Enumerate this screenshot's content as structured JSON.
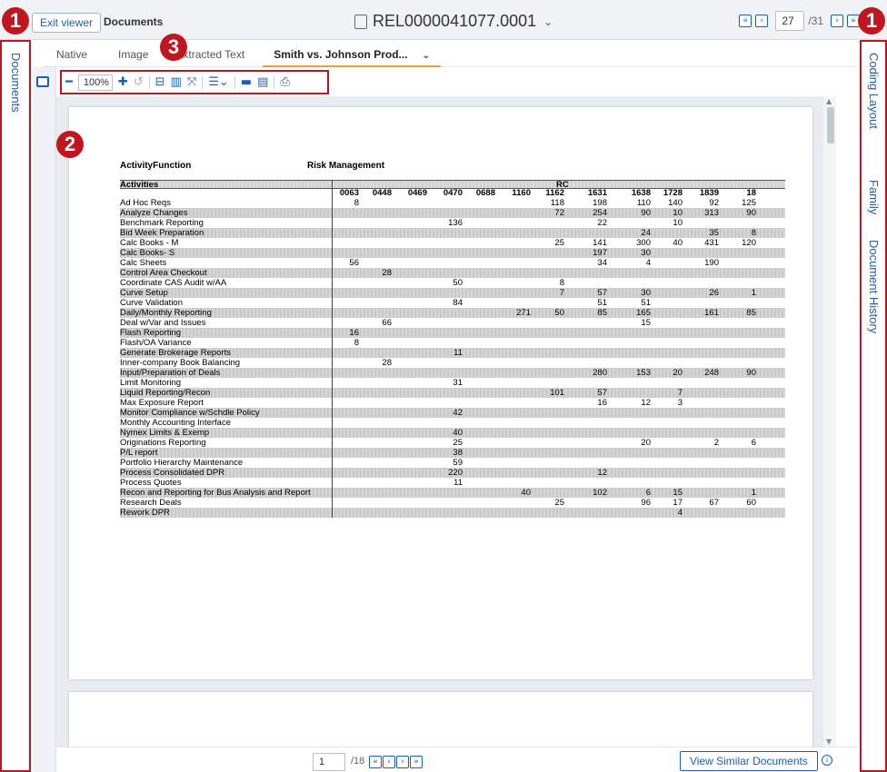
{
  "markers": {
    "left": "1",
    "right": "1",
    "toolbar": "3",
    "viewer": "2"
  },
  "header": {
    "exit_viewer": "Exit viewer",
    "documents": "Documents",
    "doc_title": "REL0000041077.0001",
    "current_page": "27",
    "total_pages": "/31"
  },
  "left_rail": {
    "label": "Documents"
  },
  "right_rail": {
    "coding_layout": "Coding Layout",
    "family": "Family",
    "document_history": "Document History"
  },
  "tabs": [
    {
      "label": "Native"
    },
    {
      "label": "Image"
    },
    {
      "label": "Extracted Text"
    },
    {
      "label": "Smith vs. Johnson Prod..."
    }
  ],
  "toolbar": {
    "zoom": "100%"
  },
  "document": {
    "activity_function_label": "ActivityFunction",
    "activity_function_value": "Risk Management",
    "activities_header": "Activities",
    "rc_header": "RC",
    "columns": [
      "0063",
      "0448",
      "0469",
      "0470",
      "0688",
      "1160",
      "1162",
      "1631",
      "1638",
      "1728",
      "1839",
      "18"
    ],
    "rows": [
      {
        "name": "Ad Hoc Reqs",
        "cells": {
          "0063": "8",
          "1162": "118",
          "1631": "198",
          "1638": "110",
          "1728": "140",
          "1839": "92",
          "18": "125"
        }
      },
      {
        "name": "Analyze Changes",
        "cells": {
          "1162": "72",
          "1631": "254",
          "1638": "90",
          "1728": "10",
          "1839": "313",
          "18": "90"
        }
      },
      {
        "name": "Benchmark Reporting",
        "cells": {
          "0470": "136",
          "1631": "22",
          "1728": "10"
        }
      },
      {
        "name": "Bid Week Preparation",
        "cells": {
          "1638": "24",
          "1839": "35",
          "18": "8"
        }
      },
      {
        "name": "Calc Books - M",
        "cells": {
          "1162": "25",
          "1631": "141",
          "1638": "300",
          "1728": "40",
          "1839": "431",
          "18": "120"
        }
      },
      {
        "name": "Calc Books- S",
        "cells": {
          "1631": "197",
          "1638": "30"
        }
      },
      {
        "name": "Calc Sheets",
        "cells": {
          "0063": "56",
          "1631": "34",
          "1638": "4",
          "1839": "190"
        }
      },
      {
        "name": "Control Area Checkout",
        "cells": {
          "0448": "28"
        }
      },
      {
        "name": "Coordinate CAS Audit w/AA",
        "cells": {
          "0470": "50",
          "1162": "8"
        }
      },
      {
        "name": "Curve Setup",
        "cells": {
          "1162": "7",
          "1631": "57",
          "1638": "30",
          "1839": "26",
          "18": "1"
        }
      },
      {
        "name": "Curve Validation",
        "cells": {
          "0470": "84",
          "1631": "51",
          "1638": "51"
        }
      },
      {
        "name": "Daily/Monthly Reporting",
        "cells": {
          "1160": "271",
          "1162": "50",
          "1631": "85",
          "1638": "165",
          "1839": "161",
          "18": "85"
        }
      },
      {
        "name": "Deal w/Var and Issues",
        "cells": {
          "0448": "66",
          "1638": "15"
        }
      },
      {
        "name": "Flash Reporting",
        "cells": {
          "0063": "16"
        }
      },
      {
        "name": "Flash/OA Variance",
        "cells": {
          "0063": "8"
        }
      },
      {
        "name": "Generate Brokerage Reports",
        "cells": {
          "0470": "11"
        }
      },
      {
        "name": "Inner-company Book Balancing",
        "cells": {
          "0448": "28"
        }
      },
      {
        "name": "Input/Preparation of Deals",
        "cells": {
          "1631": "280",
          "1638": "153",
          "1728": "20",
          "1839": "248",
          "18": "90"
        }
      },
      {
        "name": "Limit Monitoring",
        "cells": {
          "0470": "31"
        }
      },
      {
        "name": "Liquid Reporting/Recon",
        "cells": {
          "1162": "101",
          "1631": "57",
          "1728": "7"
        }
      },
      {
        "name": "Max Exposure Report",
        "cells": {
          "1631": "16",
          "1638": "12",
          "1728": "3"
        }
      },
      {
        "name": "Monitor Compliance w/Schdle Policy",
        "cells": {
          "0470": "42"
        }
      },
      {
        "name": "Monthly Accounting Interface",
        "cells": {}
      },
      {
        "name": "Nymex Limits & Exemp",
        "cells": {
          "0470": "40"
        }
      },
      {
        "name": "Originations Reporting",
        "cells": {
          "0470": "25",
          "1638": "20",
          "1839": "2",
          "18": "6"
        }
      },
      {
        "name": "P/L report",
        "cells": {
          "0470": "38"
        }
      },
      {
        "name": "Portfolio Hierarchy Maintenance",
        "cells": {
          "0470": "59"
        }
      },
      {
        "name": "Process Consolidated DPR",
        "cells": {
          "0470": "220",
          "1631": "12"
        }
      },
      {
        "name": "Process Quotes",
        "cells": {
          "0470": "11"
        }
      },
      {
        "name": "Recon and Reporting for Bus Analysis and Report",
        "cells": {
          "1160": "40",
          "1631": "102",
          "1638": "6",
          "1728": "15",
          "18": "1"
        }
      },
      {
        "name": "Research Deals",
        "cells": {
          "1162": "25",
          "1638": "96",
          "1728": "17",
          "1839": "67",
          "18": "60"
        }
      },
      {
        "name": "Rework DPR",
        "cells": {
          "1728": "4"
        }
      }
    ]
  },
  "bottom": {
    "page": "1",
    "page_total": "/18",
    "view_similar": "View Similar Documents"
  },
  "colors": {
    "accent": "#1a5fb4",
    "marker": "#c0161f",
    "active_tab": "#f0a030"
  }
}
